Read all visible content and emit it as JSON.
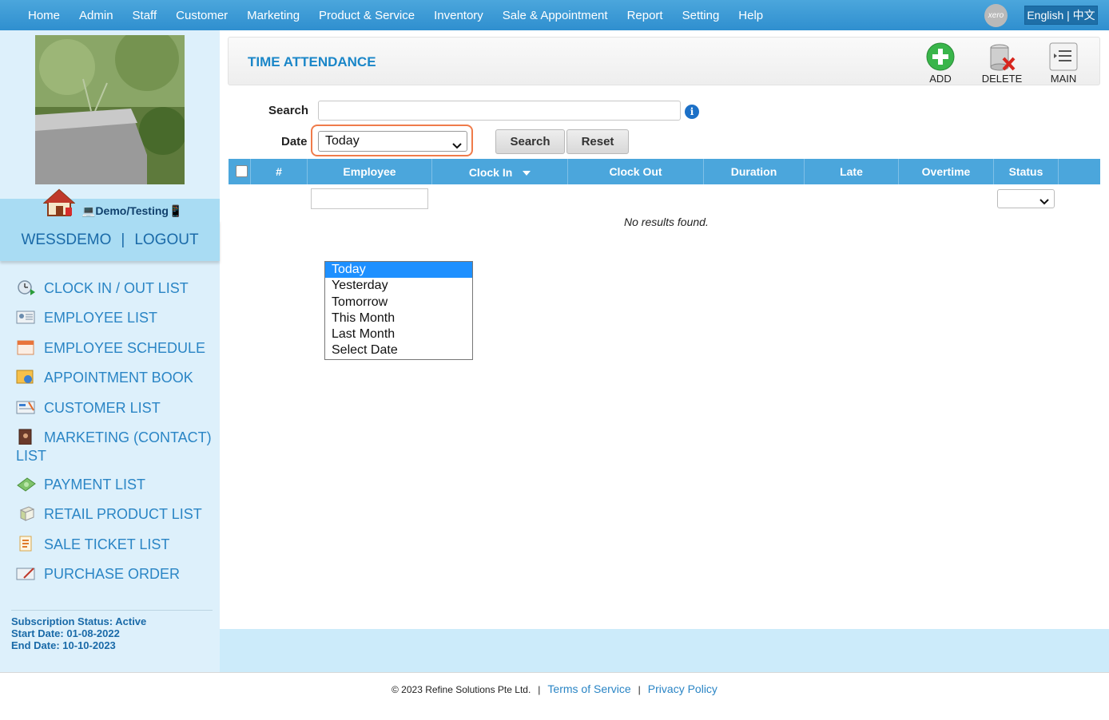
{
  "nav": {
    "items": [
      "Home",
      "Admin",
      "Staff",
      "Customer",
      "Marketing",
      "Product & Service",
      "Inventory",
      "Sale & Appointment",
      "Report",
      "Setting",
      "Help"
    ],
    "xero_label": "xero",
    "language_label": "English | 中文"
  },
  "sidebar": {
    "site_label": "💻Demo/Testing📱",
    "username": "WESSDEMO",
    "separator": "|",
    "logout_label": "LOGOUT",
    "items": [
      {
        "label": "CLOCK IN / OUT LIST",
        "icon": "clock-icon"
      },
      {
        "label": "EMPLOYEE LIST",
        "icon": "employee-card-icon"
      },
      {
        "label": "EMPLOYEE SCHEDULE",
        "icon": "calendar-icon"
      },
      {
        "label": "APPOINTMENT BOOK",
        "icon": "appointment-book-icon"
      },
      {
        "label": "CUSTOMER LIST",
        "icon": "customer-list-icon"
      },
      {
        "label": "MARKETING (CONTACT) LIST",
        "icon": "contact-book-icon"
      },
      {
        "label": "PAYMENT LIST",
        "icon": "money-icon"
      },
      {
        "label": "RETAIL PRODUCT LIST",
        "icon": "product-box-icon"
      },
      {
        "label": "SALE TICKET LIST",
        "icon": "sale-ticket-icon"
      },
      {
        "label": "PURCHASE ORDER",
        "icon": "purchase-order-icon"
      }
    ],
    "subscription": {
      "status": "Subscription Status: Active",
      "start": "Start Date: 01-08-2022",
      "end": "End Date: 10-10-2023"
    }
  },
  "header": {
    "title": "TIME ATTENDANCE",
    "add_label": "ADD",
    "delete_label": "DELETE",
    "main_label": "MAIN"
  },
  "filters": {
    "search_label": "Search",
    "search_value": "",
    "info_glyph": "i",
    "date_label": "Date",
    "date_value": "Today",
    "search_button": "Search",
    "reset_button": "Reset"
  },
  "table": {
    "columns": [
      "#",
      "Employee",
      "Clock In",
      "Clock Out",
      "Duration",
      "Late",
      "Overtime",
      "Status"
    ],
    "sorted_column": "Clock In",
    "empty_message": "No results found."
  },
  "date_dropdown": {
    "options": [
      "Today",
      "Yesterday",
      "Tomorrow",
      "This Month",
      "Last Month",
      "Select Date"
    ],
    "selected": "Today"
  },
  "footer": {
    "copyright": "© 2023 Refine Solutions Pte Ltd.",
    "separator": "|",
    "terms": "Terms of Service",
    "privacy": "Privacy Policy"
  }
}
